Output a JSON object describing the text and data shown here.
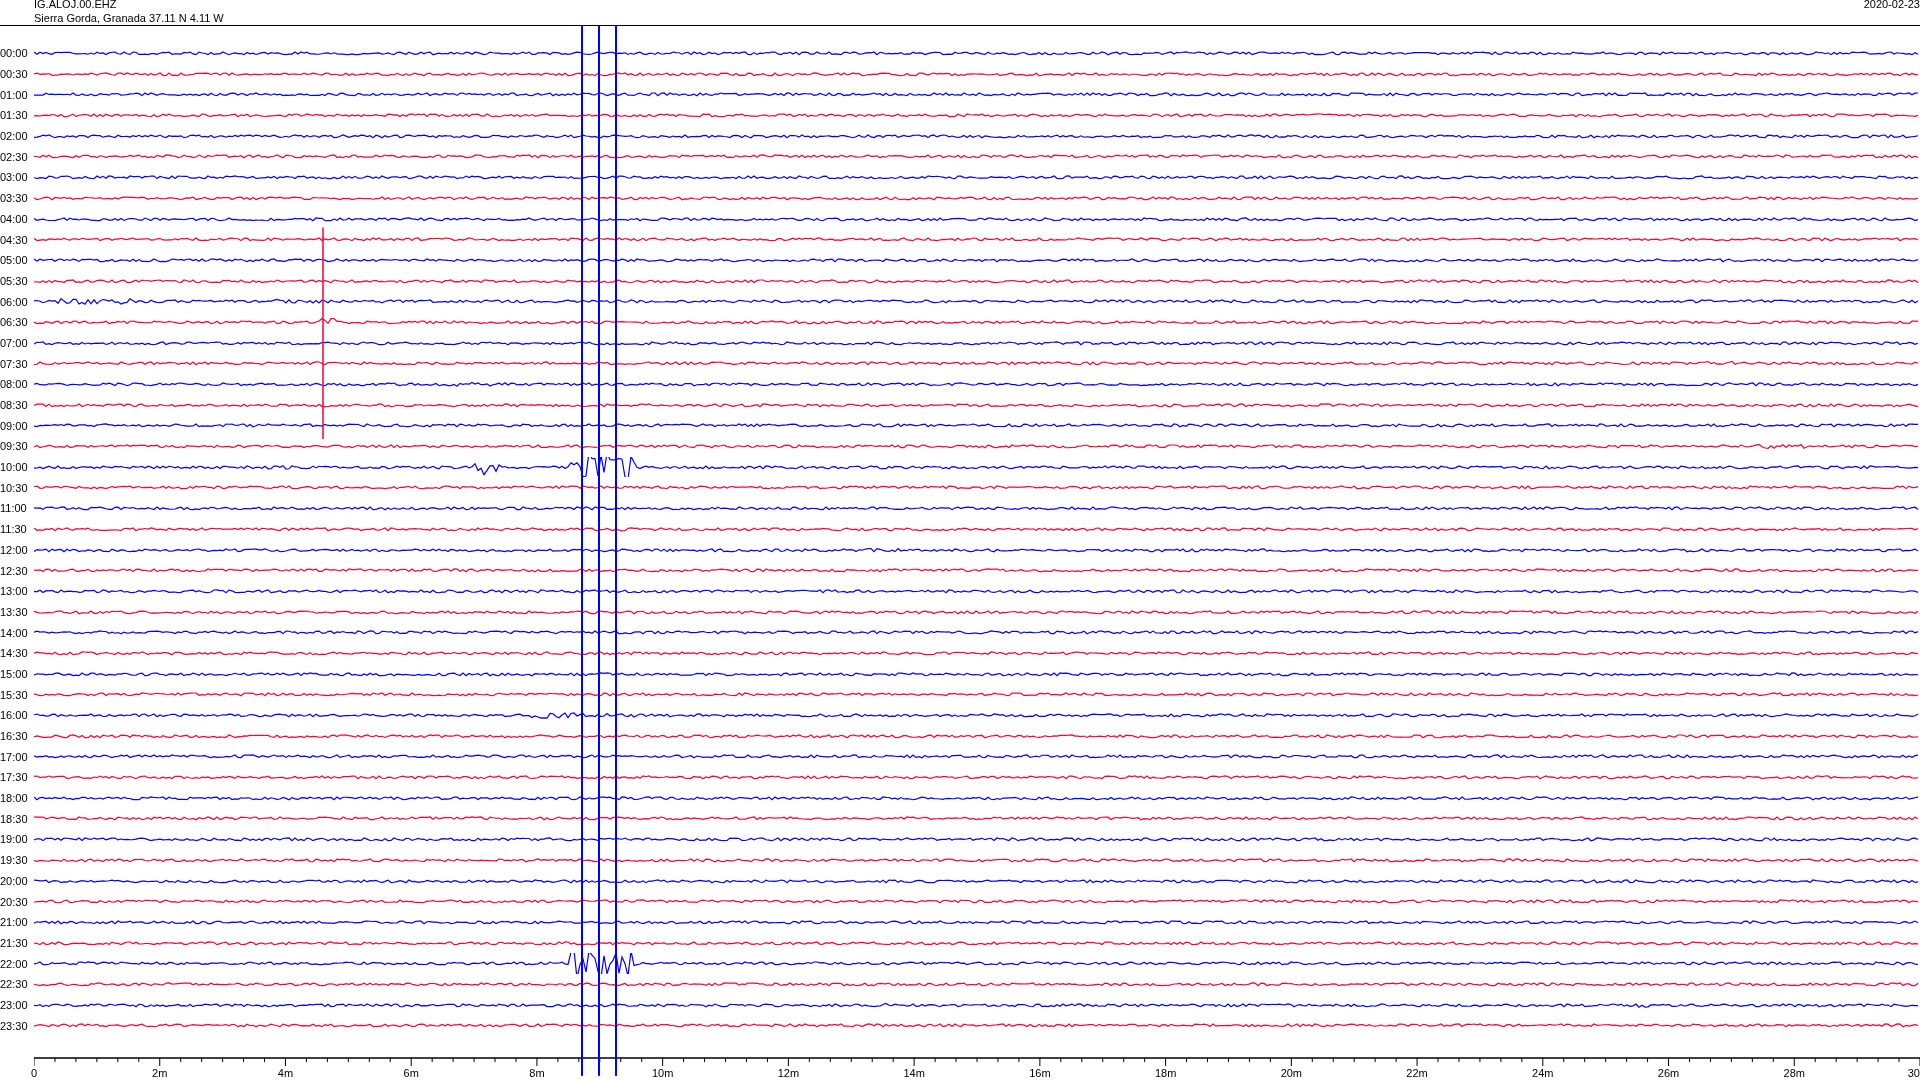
{
  "header": {
    "station": "IG.ALOJ.00.EHZ",
    "location": "Sierra Gorda, Granada  37.11 N 4.11 W",
    "date": "2020-02-23"
  },
  "traces": [
    {
      "time": "00:00",
      "color": "#0000ff"
    },
    {
      "time": "00:30",
      "color": "#ff0033"
    },
    {
      "time": "01:00",
      "color": "#0000ff"
    },
    {
      "time": "01:30",
      "color": "#ff0033"
    },
    {
      "time": "02:00",
      "color": "#0000ff"
    },
    {
      "time": "02:30",
      "color": "#ff0033"
    },
    {
      "time": "03:00",
      "color": "#0000ff"
    },
    {
      "time": "03:30",
      "color": "#ff0033"
    },
    {
      "time": "04:00",
      "color": "#0000ff"
    },
    {
      "time": "04:30",
      "color": "#ff0033"
    },
    {
      "time": "05:00",
      "color": "#0000ff"
    },
    {
      "time": "05:30",
      "color": "#ff0033"
    },
    {
      "time": "06:00",
      "color": "#0000ff"
    },
    {
      "time": "06:30",
      "color": "#ff0033"
    },
    {
      "time": "07:00",
      "color": "#0000ff"
    },
    {
      "time": "07:30",
      "color": "#ff0033"
    },
    {
      "time": "08:00",
      "color": "#0000ff"
    },
    {
      "time": "08:30",
      "color": "#ff0033"
    },
    {
      "time": "09:00",
      "color": "#0000ff"
    },
    {
      "time": "09:30",
      "color": "#ff0033"
    },
    {
      "time": "10:00",
      "color": "#0000ff"
    },
    {
      "time": "10:30",
      "color": "#ff0033"
    },
    {
      "time": "11:00",
      "color": "#0000ff"
    },
    {
      "time": "11:30",
      "color": "#ff0033"
    },
    {
      "time": "12:00",
      "color": "#0000ff"
    },
    {
      "time": "12:30",
      "color": "#ff0033"
    },
    {
      "time": "13:00",
      "color": "#0000ff"
    },
    {
      "time": "13:30",
      "color": "#ff0033"
    },
    {
      "time": "14:00",
      "color": "#0000ff"
    },
    {
      "time": "14:30",
      "color": "#ff0033"
    },
    {
      "time": "15:00",
      "color": "#0000ff"
    },
    {
      "time": "15:30",
      "color": "#ff0033"
    },
    {
      "time": "16:00",
      "color": "#0000ff"
    },
    {
      "time": "16:30",
      "color": "#ff0033"
    },
    {
      "time": "17:00",
      "color": "#0000ff"
    },
    {
      "time": "17:30",
      "color": "#ff0033"
    },
    {
      "time": "18:00",
      "color": "#0000ff"
    },
    {
      "time": "18:30",
      "color": "#ff0033"
    },
    {
      "time": "19:00",
      "color": "#0000ff"
    },
    {
      "time": "19:30",
      "color": "#ff0033"
    },
    {
      "time": "20:00",
      "color": "#0000ff"
    },
    {
      "time": "20:30",
      "color": "#ff0033"
    },
    {
      "time": "21:00",
      "color": "#0000ff"
    },
    {
      "time": "21:30",
      "color": "#ff0033"
    },
    {
      "time": "22:00",
      "color": "#0000ff"
    },
    {
      "time": "22:30",
      "color": "#ff0033"
    },
    {
      "time": "23:00",
      "color": "#0000ff"
    },
    {
      "time": "23:30",
      "color": "#ff0033"
    }
  ],
  "x_axis": {
    "labels": [
      "0",
      "2m",
      "4m",
      "6m",
      "8m",
      "10m",
      "12m",
      "14m",
      "16m",
      "18m",
      "20m",
      "22m",
      "24m",
      "26m",
      "28m",
      "30"
    ]
  }
}
